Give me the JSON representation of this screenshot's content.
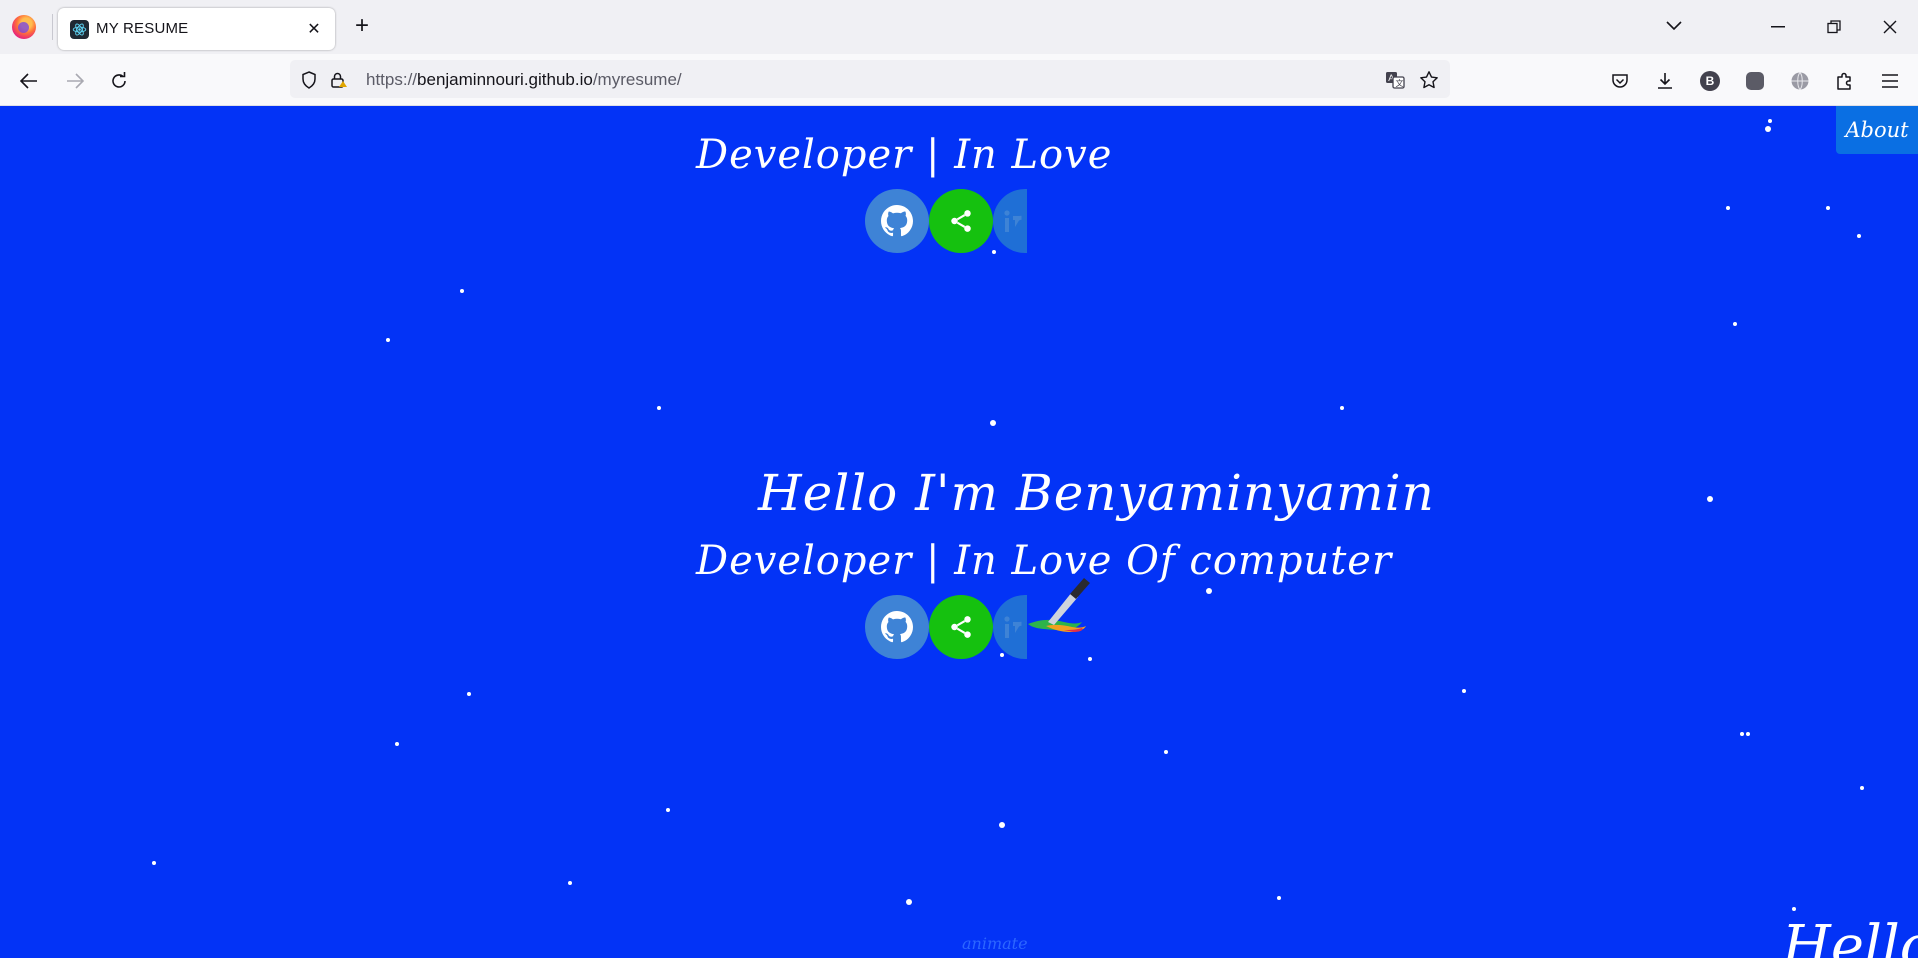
{
  "browser": {
    "tab": {
      "title": "MY RESUME"
    },
    "url": {
      "scheme": "https://",
      "host": "benjaminnouri.github.io",
      "path": "/myresume/"
    }
  },
  "page": {
    "subtitle_top": "Developer | In Love",
    "greeting": "Hello I'm Benyaminyamin",
    "subtitle_mid": "Developer | In Love Of computer",
    "about_label": "About",
    "animate_label": "animate",
    "corner_text": "Hello",
    "background_color": "#0333f6",
    "social_icons": [
      "github-icon",
      "share-icon",
      "linkedin-icon"
    ]
  }
}
